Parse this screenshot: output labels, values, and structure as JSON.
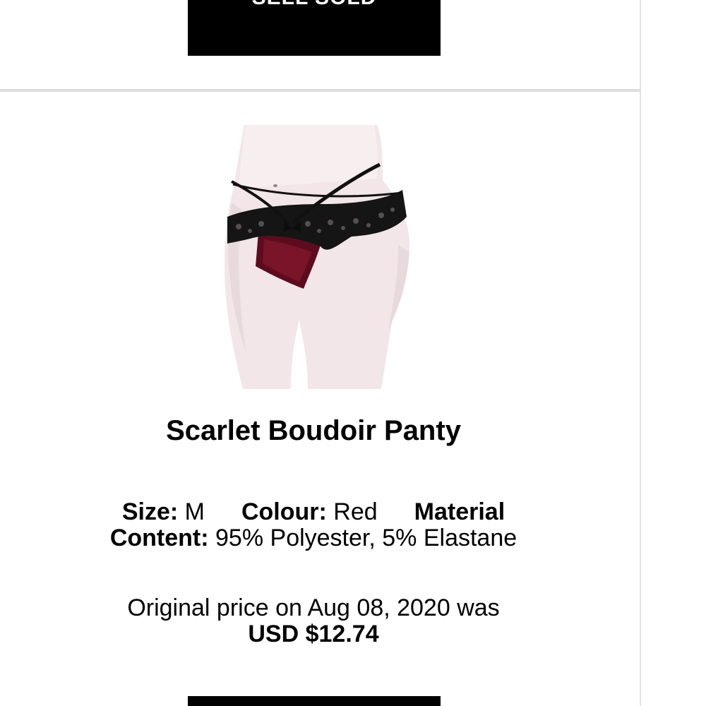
{
  "top_button": {
    "label": "SELL SOLD"
  },
  "product": {
    "title": "Scarlet Boudoir Panty",
    "image_alt": "Black lace and red panty",
    "details": {
      "size_label": "Size:",
      "size_value": "M",
      "colour_label": "Colour:",
      "colour_value": "Red",
      "material_label": "Material Content:",
      "material_value": "95% Polyester, 5% Elastane"
    },
    "price": {
      "prefix": "Original price on Aug 08, 2020 was",
      "amount": "USD $12.74"
    }
  },
  "bottom_button": {
    "label": ""
  },
  "colors": {
    "button_bg": "#000000",
    "divider": "#dcdde3",
    "text": "#000000"
  }
}
